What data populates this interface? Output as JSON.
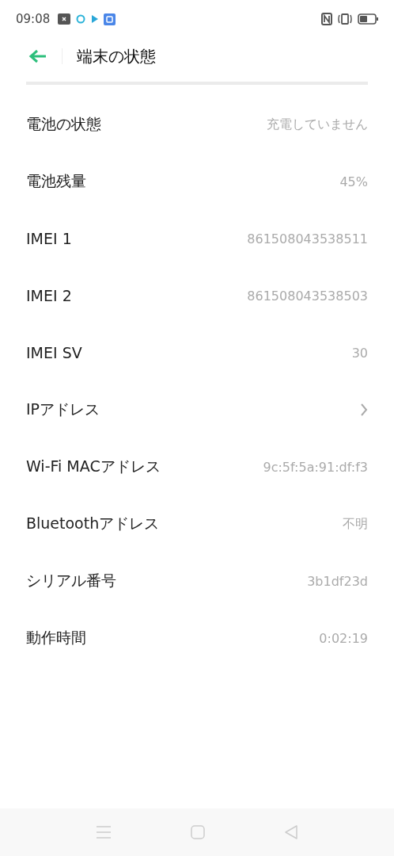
{
  "status_bar": {
    "time": "09:08"
  },
  "header": {
    "title": "端末の状態"
  },
  "rows": [
    {
      "kind": "value",
      "label": "電池の状態",
      "value": "充電していません"
    },
    {
      "kind": "value",
      "label": "電池残量",
      "value": "45%"
    },
    {
      "kind": "value",
      "label": "IMEI 1",
      "value": "861508043538511"
    },
    {
      "kind": "value",
      "label": "IMEI 2",
      "value": "861508043538503"
    },
    {
      "kind": "value",
      "label": "IMEI SV",
      "value": "30"
    },
    {
      "kind": "link",
      "label": "IPアドレス"
    },
    {
      "kind": "value",
      "label": "Wi-Fi MACアドレス",
      "value": "9c:5f:5a:91:df:f3"
    },
    {
      "kind": "value",
      "label": "Bluetoothアドレス",
      "value": "不明"
    },
    {
      "kind": "value",
      "label": "シリアル番号",
      "value": "3b1df23d"
    },
    {
      "kind": "value",
      "label": "動作時間",
      "value": "0:02:19"
    }
  ]
}
